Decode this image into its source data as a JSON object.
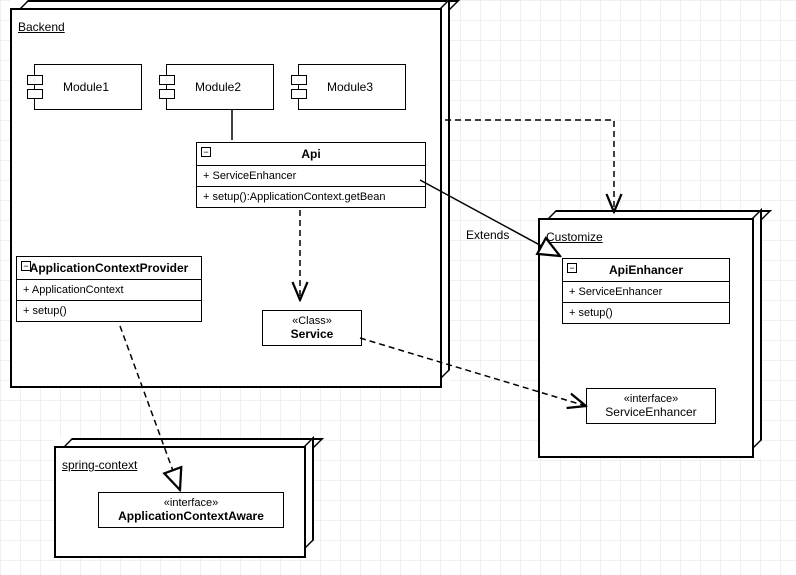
{
  "packages": {
    "backend": {
      "label": "Backend"
    },
    "customize": {
      "label": "Customize"
    },
    "springContext": {
      "label": "spring-context"
    }
  },
  "components": {
    "module1": {
      "label": "Module1"
    },
    "module2": {
      "label": "Module2"
    },
    "module3": {
      "label": "Module3"
    }
  },
  "classes": {
    "api": {
      "name": "Api",
      "attr1": "+ ServiceEnhancer",
      "op1": "+ setup():ApplicationContext.getBean"
    },
    "appCtxProvider": {
      "name": "ApplicationContextProvider",
      "attr1": "+ ApplicationContext",
      "op1": "+ setup()"
    },
    "service": {
      "stereo": "«Class»",
      "name": "Service"
    },
    "apiEnhancer": {
      "name": "ApiEnhancer",
      "attr1": "+ ServiceEnhancer",
      "op1": "+ setup()"
    },
    "serviceEnhancer": {
      "stereo": "«interface»",
      "name": "ServiceEnhancer"
    },
    "appCtxAware": {
      "stereo": "«interface»",
      "name": "ApplicationContextAware"
    }
  },
  "labels": {
    "extends": "Extends"
  }
}
